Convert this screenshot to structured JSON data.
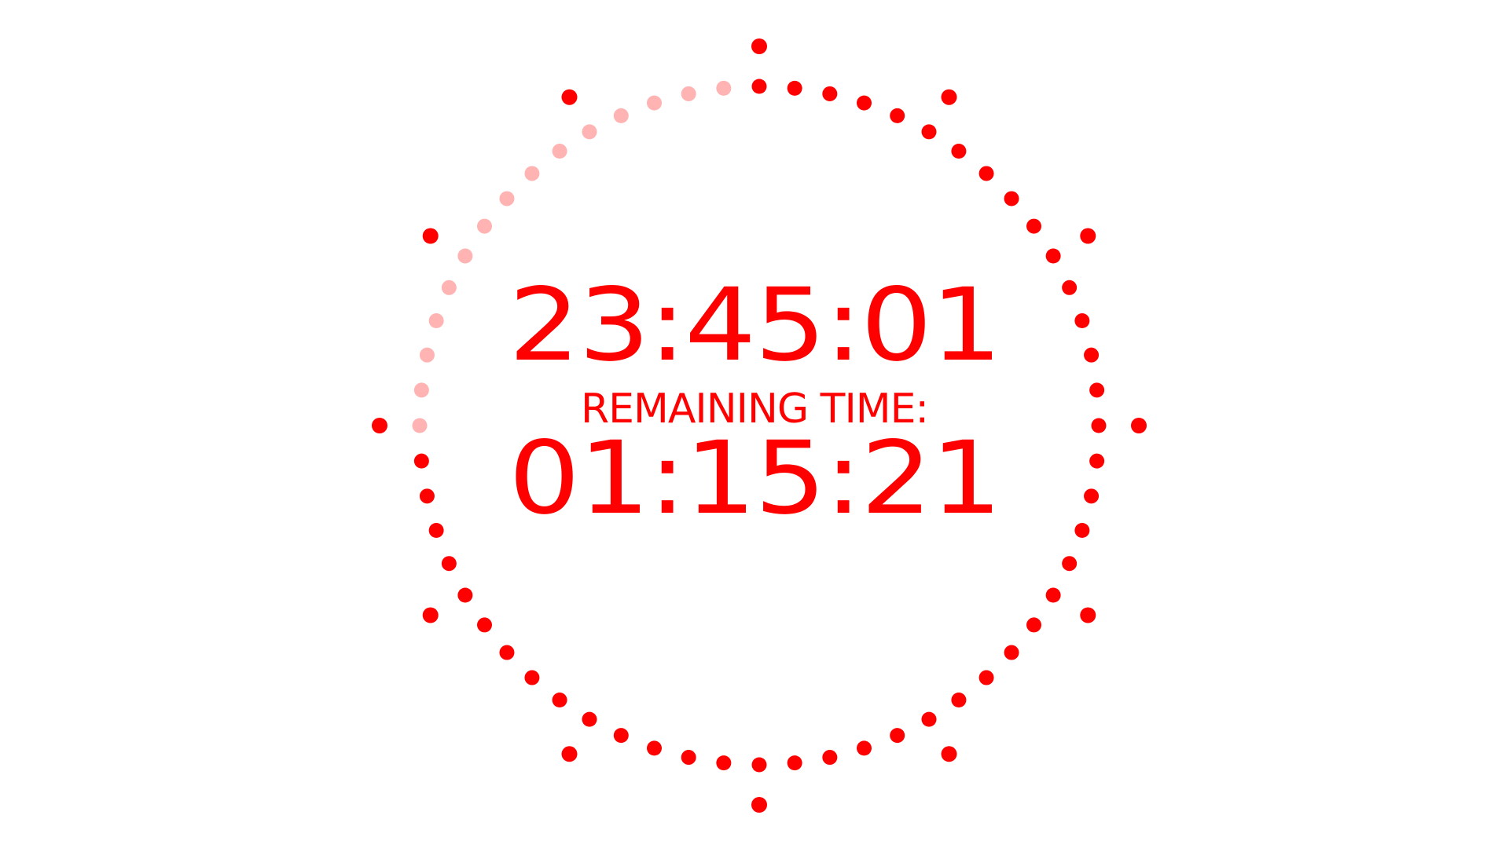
{
  "colors": {
    "accent": "#ff0000",
    "elapsed": "#ffb3b3",
    "background": "#ffffff"
  },
  "clock": {
    "current_time": "23:45:01",
    "remaining_label": "REMAINING TIME:",
    "remaining_time": "01:15:21"
  },
  "dial": {
    "total_dots": 60,
    "remaining_fraction": 0.75,
    "hour_markers": 12
  }
}
